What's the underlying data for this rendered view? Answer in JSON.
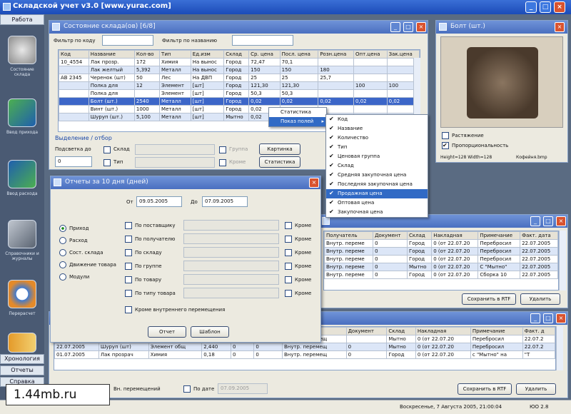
{
  "app": {
    "title": "Складской учет v3.0 [www.yurac.com]"
  },
  "sidebar": {
    "header": "Работа",
    "items": [
      {
        "label": "Состояние склада"
      },
      {
        "label": "Ввод прихода"
      },
      {
        "label": "Ввод расхода"
      },
      {
        "label": "Справочники и журналы"
      },
      {
        "label": "Перерасчет"
      }
    ],
    "bottom": [
      "Хронология",
      "Отчеты",
      "Справка"
    ]
  },
  "stock_window": {
    "title": "Состояние склада(ов) [6/8]",
    "filter_code_label": "Фильтр по коду",
    "filter_name_label": "Фильтр по названию",
    "columns": [
      "Код",
      "Название",
      "Кол-во",
      "Тип",
      "Ед.изм",
      "Склад",
      "Ср. цена",
      "Посл. цена",
      "Розн.цена",
      "Опт.цена",
      "Зак.цена"
    ],
    "rows": [
      [
        "10_4554",
        "Лак прозр.",
        "172",
        "Химия",
        "На вынос",
        "Город",
        "72,47",
        "70,1",
        "",
        "",
        ""
      ],
      [
        "",
        "Лак желтый",
        "5,392",
        "Металл",
        "На вынос",
        "Город",
        "150",
        "150",
        "180",
        "",
        ""
      ],
      [
        "AB 2345",
        "Черенок (шт)",
        "50",
        "Лес",
        "На ДВП",
        "Город",
        "25",
        "25",
        "25,7",
        "",
        ""
      ],
      [
        "",
        "Полка для",
        "12",
        "Элемент",
        "[шт]",
        "Город",
        "121,30",
        "121,30",
        "",
        "100",
        "100"
      ],
      [
        "",
        "Полка для",
        "",
        "Элемент",
        "[шт]",
        "Город",
        "50,3",
        "50,3",
        "",
        "",
        ""
      ],
      [
        "",
        "Болт (шт.)",
        "2540",
        "Металл",
        "[шт]",
        "Город",
        "0,02",
        "0,02",
        "0,02",
        "0,02",
        "0,02"
      ],
      [
        "",
        "Винт (шт.)",
        "1000",
        "Металл",
        "[шт]",
        "Город",
        "0,02",
        "",
        "",
        "",
        ""
      ],
      [
        "",
        "Шуруп (шт.)",
        "5,100",
        "Металл",
        "[шт]",
        "Мытно",
        "0,02",
        "0,02",
        "",
        "",
        ""
      ]
    ],
    "select_label": "Выделение / отбор",
    "highlight_label": "Подсветка до",
    "spin_value": "0",
    "warehouse_label": "Склад",
    "type_label": "Тип",
    "group_label": "Группа",
    "save_label": "Кроме",
    "picture_button": "Картинка",
    "stats_button": "Статистика"
  },
  "context_menu": {
    "items": [
      "Статистика",
      "Показ полей"
    ]
  },
  "fields_menu": {
    "items": [
      {
        "label": "Код",
        "checked": true
      },
      {
        "label": "Название",
        "checked": true
      },
      {
        "label": "Количество",
        "checked": true
      },
      {
        "label": "Тип",
        "checked": true
      },
      {
        "label": "Ценовая группа",
        "checked": true
      },
      {
        "label": "Склад",
        "checked": true
      },
      {
        "label": "Средняя закупочная цена",
        "checked": true
      },
      {
        "label": "Последняя закупочная цена",
        "checked": true
      },
      {
        "label": "Продажная цена",
        "checked": true
      },
      {
        "label": "Оптовая цена",
        "checked": true
      },
      {
        "label": "Закупочная цена",
        "checked": true
      }
    ]
  },
  "image_window": {
    "title": "Болт (шт.)",
    "stretch_label": "Растяжение",
    "proportional_label": "Пропорциональность",
    "info": "Height=128 Width=128",
    "file": "Кофейня.bmp"
  },
  "report_window": {
    "title": "Отчеты за 10 дня (дней)",
    "from_label": "От",
    "from_value": "09.05.2005",
    "to_label": "До",
    "to_value": "07.09.2005",
    "radios": [
      "Приход",
      "Расход",
      "Сост. склада",
      "Движение товара",
      "Модули"
    ],
    "filters": [
      "По поставщику",
      "По получателю",
      "По складу",
      "По группе",
      "По товару",
      "По типу товара"
    ],
    "except_label": "Кроме",
    "internal_label": "Кроме внутреннего перемещения",
    "report_button": "Отчет",
    "template_button": "Шаблон"
  },
  "move_window": {
    "columns": [
      "Получатель",
      "Документ",
      "Склад",
      "Накладная",
      "Примечание",
      "Факт. дата"
    ],
    "rows": [
      [
        "Внутр. переме",
        "0",
        "Город",
        "0 (от 22.07.20",
        "Перебросил",
        "22.07.2005"
      ],
      [
        "Внутр. переме",
        "0",
        "Город",
        "0 (от 22.07.20",
        "Перебросил",
        "22.07.2005"
      ],
      [
        "Внутр. переме",
        "0",
        "Город",
        "0 (от 22.07.20",
        "Перебросил",
        "22.07.2005"
      ],
      [
        "Внутр. переме",
        "0",
        "Мытно",
        "0 (от 22.07.20",
        "С \"Мытно\"",
        "22.07.2005"
      ],
      [
        "Внутр. переме",
        "0",
        "Город",
        "0 (от 22.07.20",
        "Сборка 10",
        "22.07.2005"
      ]
    ],
    "save_rtf": "Сохранить в RTF",
    "delete": "Удалить"
  },
  "journal_window": {
    "columns": [
      "Дата",
      "Название",
      "Тип",
      "Кол-во",
      "Цена",
      "Сумма",
      "Поставщик",
      "Документ",
      "Склад",
      "Накладная",
      "Примечание",
      "Факт. д"
    ],
    "rows": [
      [
        "22.07.2005",
        "Шуруп (шт)",
        "Элемент общ",
        "2,400",
        "0",
        "0",
        "Внутр. перемещ",
        "",
        "Мытно",
        "0 (от 22.07.20",
        "Перебросил",
        "22.07.2"
      ],
      [
        "22.07.2005",
        "Шуруп (шт)",
        "Элемент общ",
        "2,440",
        "0",
        "0",
        "Внутр. перемещ",
        "0",
        "Мытно",
        "0 (от 22.07.20",
        "Перебросил",
        "22.07.2"
      ],
      [
        "01.07.2005",
        "Лак прозрач",
        "Химия",
        "0,18",
        "0",
        "0",
        "Внутр. перемещ",
        "0",
        "Город",
        "0 (от 22.07.20",
        "с \"Мытно\" на",
        "\"Т"
      ]
    ],
    "move_combo": "Вн. перемещений",
    "by_date_label": "По дате",
    "date_value": "07.09.2005",
    "save_rtf": "Сохранить в RTF",
    "delete": "Удалить"
  },
  "status": {
    "datetime": "Воскресенье, 7 Августа 2005, 21:00:04",
    "version": "ЮО 2.8"
  },
  "watermark": "1.44mb.ru"
}
